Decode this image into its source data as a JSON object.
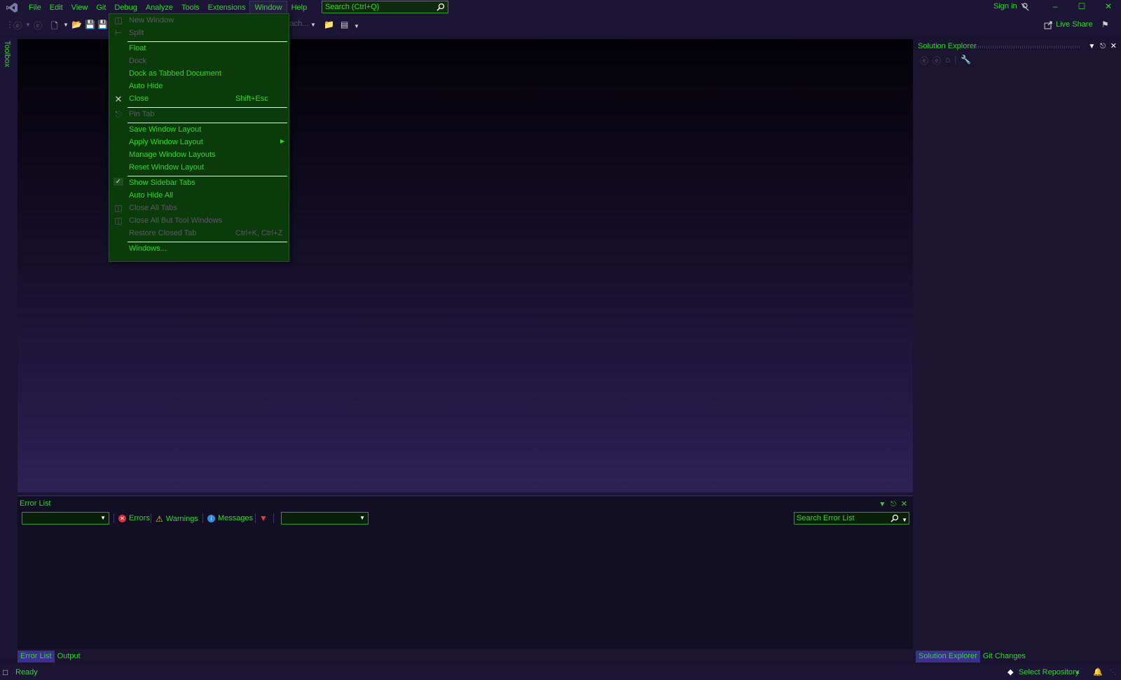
{
  "menubar": {
    "items": [
      "File",
      "Edit",
      "View",
      "Git",
      "Debug",
      "Analyze",
      "Tools",
      "Extensions",
      "Window",
      "Help"
    ],
    "search_placeholder": "Search (Ctrl+Q)",
    "sign_in": "Sign in"
  },
  "toolbar": {
    "attach_label": "Attach...",
    "live_share": "Live Share"
  },
  "toolbox": {
    "label": "Toolbox"
  },
  "window_menu": {
    "items": [
      {
        "label": "New Window",
        "shortcut": "",
        "enabled": false,
        "icon": "new-window-icon"
      },
      {
        "label": "Split",
        "shortcut": "",
        "enabled": false,
        "icon": "split-icon"
      },
      {
        "label": "Float",
        "shortcut": "",
        "enabled": true
      },
      {
        "label": "Dock",
        "shortcut": "",
        "enabled": false
      },
      {
        "label": "Dock as Tabbed Document",
        "shortcut": "",
        "enabled": true
      },
      {
        "label": "Auto Hide",
        "shortcut": "",
        "enabled": true
      },
      {
        "label": "Close",
        "shortcut": "Shift+Esc",
        "enabled": true,
        "icon": "close-icon"
      },
      {
        "label": "Pin Tab",
        "shortcut": "",
        "enabled": false,
        "icon": "pin-icon"
      },
      {
        "label": "Save Window Layout",
        "shortcut": "",
        "enabled": true
      },
      {
        "label": "Apply Window Layout",
        "shortcut": "",
        "enabled": true,
        "submenu": true
      },
      {
        "label": "Manage Window Layouts",
        "shortcut": "",
        "enabled": true
      },
      {
        "label": "Reset Window Layout",
        "shortcut": "",
        "enabled": true
      },
      {
        "label": "Show Sidebar Tabs",
        "shortcut": "",
        "enabled": true,
        "checked": true
      },
      {
        "label": "Auto Hide All",
        "shortcut": "",
        "enabled": true
      },
      {
        "label": "Close All Tabs",
        "shortcut": "",
        "enabled": false,
        "icon": "close-tabs-icon"
      },
      {
        "label": "Close All But Tool Windows",
        "shortcut": "",
        "enabled": false,
        "icon": "close-tabs-icon"
      },
      {
        "label": "Restore Closed Tab",
        "shortcut": "Ctrl+K, Ctrl+Z",
        "enabled": false
      },
      {
        "label": "Windows...",
        "shortcut": "",
        "enabled": true
      }
    ]
  },
  "error_list": {
    "title": "Error List",
    "errors_label": "Errors",
    "warnings_label": "Warnings",
    "messages_label": "Messages",
    "search_placeholder": "Search Error List"
  },
  "bottom_tabs": [
    "Error List",
    "Output"
  ],
  "solution_explorer": {
    "title": "Solution Explorer",
    "tabs": [
      "Solution Explorer",
      "Git Changes"
    ]
  },
  "statusbar": {
    "ready": "Ready",
    "select_repository": "Select Repository"
  },
  "colors": {
    "accent_green": "#33d62f",
    "menu_bg": "#0b3a0b",
    "chrome_bg": "#1c1535",
    "tab_active": "#3b2f8f"
  }
}
